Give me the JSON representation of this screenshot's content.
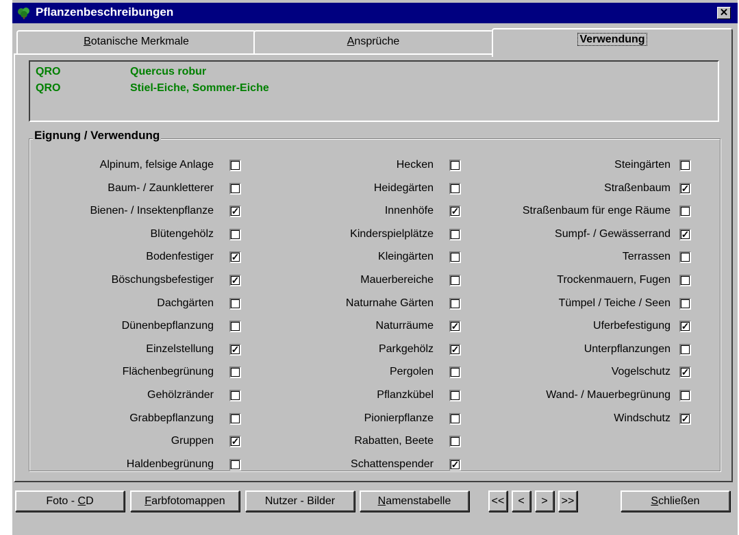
{
  "window": {
    "title": "Pflanzenbeschreibungen",
    "close_glyph": "✕"
  },
  "tabs": [
    {
      "prefix": "",
      "u": "B",
      "rest": "otanische Merkmale"
    },
    {
      "prefix": "",
      "u": "A",
      "rest": "nsprüche"
    },
    {
      "prefix": "",
      "u": "",
      "rest": "Verwendung"
    }
  ],
  "info": {
    "rows": [
      {
        "code": "QRO",
        "name": "Quercus robur"
      },
      {
        "code": "QRO",
        "name": "Stiel-Eiche, Sommer-Eiche"
      }
    ]
  },
  "group_label": "Eignung / Verwendung",
  "columns": [
    [
      {
        "label": "Alpinum, felsige Anlage",
        "checked": false
      },
      {
        "label": "Baum- / Zaunkletterer",
        "checked": false
      },
      {
        "label": "Bienen- / Insektenpflanze",
        "checked": true
      },
      {
        "label": "Blütengehölz",
        "checked": false
      },
      {
        "label": "Bodenfestiger",
        "checked": true
      },
      {
        "label": "Böschungsbefestiger",
        "checked": true
      },
      {
        "label": "Dachgärten",
        "checked": false
      },
      {
        "label": "Dünenbepflanzung",
        "checked": false
      },
      {
        "label": "Einzelstellung",
        "checked": true
      },
      {
        "label": "Flächenbegrünung",
        "checked": false
      },
      {
        "label": "Gehölzränder",
        "checked": false
      },
      {
        "label": "Grabbepflanzung",
        "checked": false
      },
      {
        "label": "Gruppen",
        "checked": true
      },
      {
        "label": "Haldenbegrünung",
        "checked": false
      }
    ],
    [
      {
        "label": "Hecken",
        "checked": false
      },
      {
        "label": "Heidegärten",
        "checked": false
      },
      {
        "label": "Innenhöfe",
        "checked": true
      },
      {
        "label": "Kinderspielplätze",
        "checked": false
      },
      {
        "label": "Kleingärten",
        "checked": false
      },
      {
        "label": "Mauerbereiche",
        "checked": false
      },
      {
        "label": "Naturnahe Gärten",
        "checked": false
      },
      {
        "label": "Naturräume",
        "checked": true
      },
      {
        "label": "Parkgehölz",
        "checked": true
      },
      {
        "label": "Pergolen",
        "checked": false
      },
      {
        "label": "Pflanzkübel",
        "checked": false
      },
      {
        "label": "Pionierpflanze",
        "checked": false
      },
      {
        "label": "Rabatten, Beete",
        "checked": false
      },
      {
        "label": "Schattenspender",
        "checked": true
      }
    ],
    [
      {
        "label": "Steingärten",
        "checked": false
      },
      {
        "label": "Straßenbaum",
        "checked": true
      },
      {
        "label": "Straßenbaum für enge Räume",
        "checked": false
      },
      {
        "label": "Sumpf- / Gewässerrand",
        "checked": true
      },
      {
        "label": "Terrassen",
        "checked": false
      },
      {
        "label": "Trockenmauern, Fugen",
        "checked": false
      },
      {
        "label": "Tümpel / Teiche / Seen",
        "checked": false
      },
      {
        "label": "Uferbefestigung",
        "checked": true
      },
      {
        "label": "Unterpflanzungen",
        "checked": false
      },
      {
        "label": "Vogelschutz",
        "checked": true
      },
      {
        "label": "Wand- / Mauerbegrünung",
        "checked": false
      },
      {
        "label": "Windschutz",
        "checked": true
      }
    ]
  ],
  "check_glyph": "✓",
  "buttons": {
    "foto_cd": {
      "prefix": "Foto - ",
      "u": "C",
      "rest": "D"
    },
    "farbfotomappen": {
      "prefix": "",
      "u": "F",
      "rest": "arbfotomappen"
    },
    "nutzer_bilder": {
      "prefix": "Nutzer - Bilder",
      "u": "",
      "rest": ""
    },
    "namenstabelle": {
      "prefix": "",
      "u": "N",
      "rest": "amenstabelle"
    },
    "first": {
      "prefix": "<<",
      "u": "",
      "rest": ""
    },
    "prev": {
      "prefix": "<",
      "u": "",
      "rest": ""
    },
    "next": {
      "prefix": ">",
      "u": "",
      "rest": ""
    },
    "last": {
      "prefix": ">>",
      "u": "",
      "rest": ""
    },
    "schliessen": {
      "prefix": "",
      "u": "S",
      "rest": "chließen"
    }
  },
  "colors": {
    "titlebar": "#000080",
    "face": "#c0c0c0",
    "accent_text": "#008000"
  }
}
